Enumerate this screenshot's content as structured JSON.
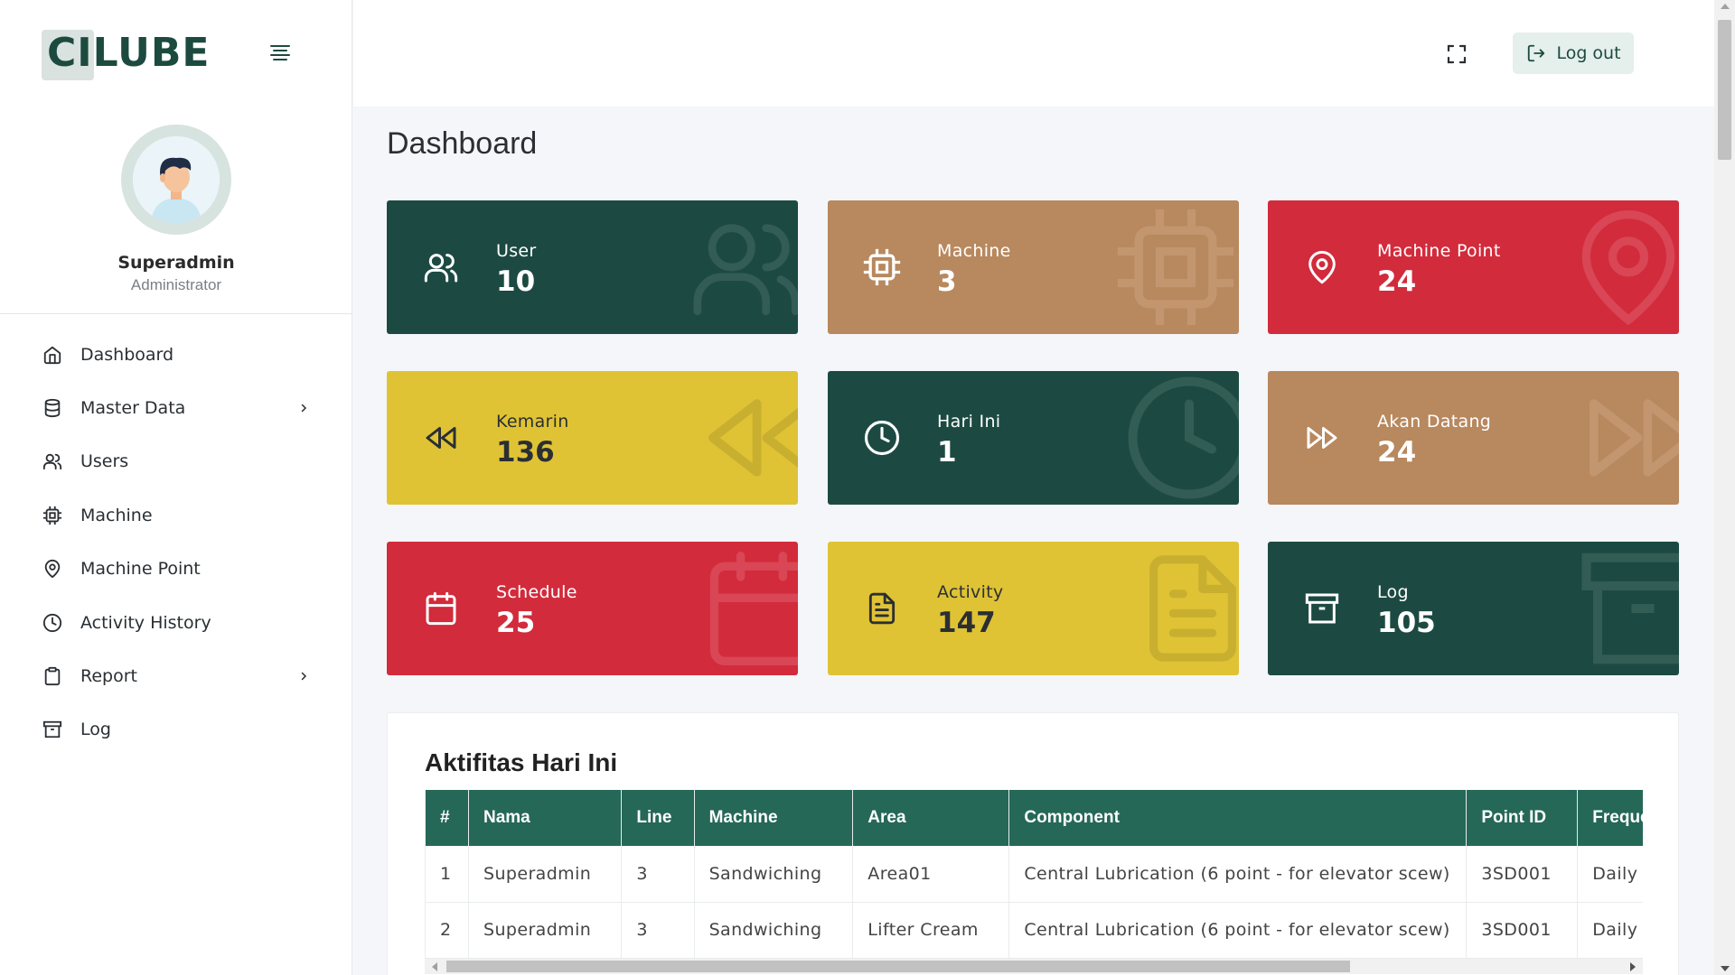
{
  "brand": {
    "name": "CILUBE"
  },
  "profile": {
    "name": "Superadmin",
    "role": "Administrator"
  },
  "sidebar": {
    "items": [
      {
        "label": "Dashboard",
        "icon": "home-icon",
        "has_submenu": false
      },
      {
        "label": "Master Data",
        "icon": "database-icon",
        "has_submenu": true
      },
      {
        "label": "Users",
        "icon": "users-icon",
        "has_submenu": false
      },
      {
        "label": "Machine",
        "icon": "cpu-icon",
        "has_submenu": false
      },
      {
        "label": "Machine Point",
        "icon": "map-pin-icon",
        "has_submenu": false
      },
      {
        "label": "Activity History",
        "icon": "clock-icon",
        "has_submenu": false
      },
      {
        "label": "Report",
        "icon": "clipboard-icon",
        "has_submenu": true
      },
      {
        "label": "Log",
        "icon": "archive-icon",
        "has_submenu": false
      }
    ]
  },
  "topbar": {
    "logout_label": "Log out"
  },
  "page": {
    "title": "Dashboard"
  },
  "cards": [
    {
      "label": "User",
      "value": "10",
      "color": "#1c4a42",
      "icon": "users-icon"
    },
    {
      "label": "Machine",
      "value": "3",
      "color": "#b8885e",
      "icon": "cpu-icon"
    },
    {
      "label": "Machine Point",
      "value": "24",
      "color": "#d22b3c",
      "icon": "map-pin-icon"
    },
    {
      "label": "Kemarin",
      "value": "136",
      "color": "#dfc335",
      "icon": "rewind-icon"
    },
    {
      "label": "Hari Ini",
      "value": "1",
      "color": "#1c4a42",
      "icon": "clock-icon"
    },
    {
      "label": "Akan Datang",
      "value": "24",
      "color": "#b8885e",
      "icon": "fast-forward-icon"
    },
    {
      "label": "Schedule",
      "value": "25",
      "color": "#d22b3c",
      "icon": "calendar-icon"
    },
    {
      "label": "Activity",
      "value": "147",
      "color": "#dfc335",
      "icon": "file-text-icon"
    },
    {
      "label": "Log",
      "value": "105",
      "color": "#1c4a42",
      "icon": "archive-icon"
    }
  ],
  "activity_table": {
    "title": "Aktifitas Hari Ini",
    "columns": [
      "#",
      "Nama",
      "Line",
      "Machine",
      "Area",
      "Component",
      "Point ID",
      "Frequency"
    ],
    "rows": [
      [
        "1",
        "Superadmin",
        "3",
        "Sandwiching",
        "Area01",
        "Central Lubrication (6 point - for elevator scew)",
        "3SD001",
        "Daily"
      ],
      [
        "2",
        "Superadmin",
        "3",
        "Sandwiching",
        "Lifter Cream",
        "Central Lubrication (6 point - for elevator scew)",
        "3SD001",
        "Daily"
      ]
    ]
  }
}
